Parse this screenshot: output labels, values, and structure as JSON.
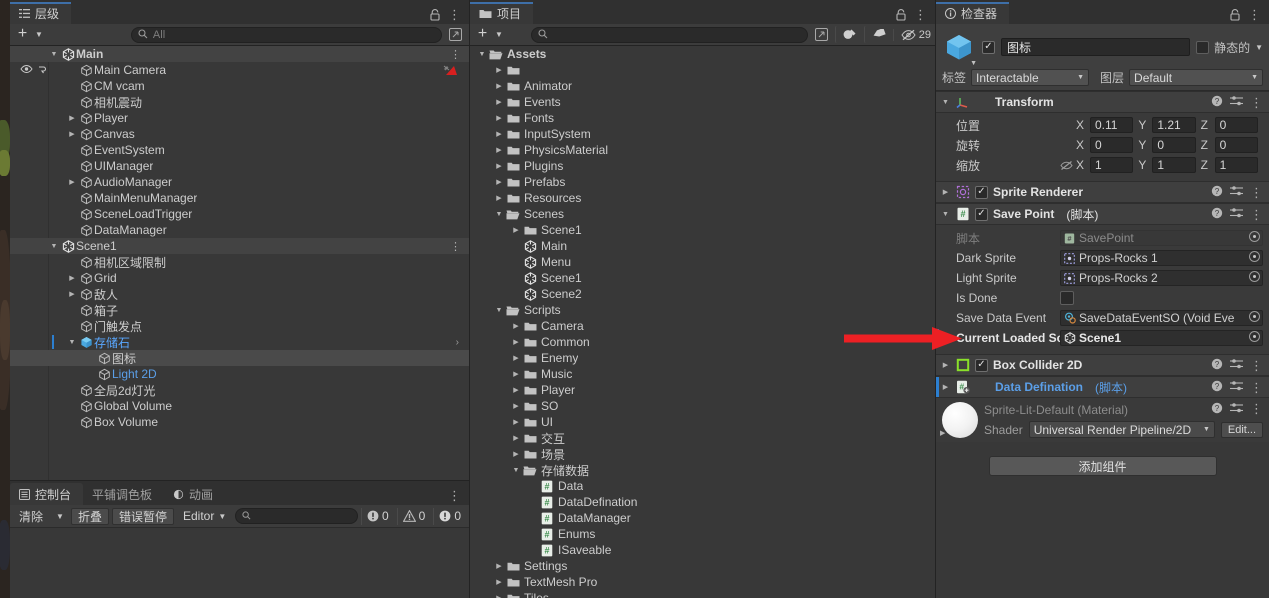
{
  "hierarchy": {
    "tab_label": "层级",
    "tab_icon": "hierarchy-icon",
    "toolbar": {
      "create_label": "+",
      "search_placeholder": "All"
    },
    "rows": [
      {
        "label": "Main",
        "indent": 1,
        "icon": "unity-scene-icon",
        "twirl": "down",
        "bold": true,
        "kebab": true
      },
      {
        "label": "Main Camera",
        "indent": 2,
        "icon": "gameobject-icon",
        "twirl": "none",
        "vis": true,
        "camicon": true
      },
      {
        "label": "CM vcam",
        "indent": 2,
        "icon": "gameobject-icon",
        "twirl": "none"
      },
      {
        "label": "相机震动",
        "indent": 2,
        "icon": "gameobject-icon",
        "twirl": "none"
      },
      {
        "label": "Player",
        "indent": 2,
        "icon": "gameobject-icon",
        "twirl": "right"
      },
      {
        "label": "Canvas",
        "indent": 2,
        "icon": "gameobject-icon",
        "twirl": "right"
      },
      {
        "label": "EventSystem",
        "indent": 2,
        "icon": "gameobject-icon",
        "twirl": "none"
      },
      {
        "label": "UIManager",
        "indent": 2,
        "icon": "gameobject-icon",
        "twirl": "none"
      },
      {
        "label": "AudioManager",
        "indent": 2,
        "icon": "gameobject-icon",
        "twirl": "right"
      },
      {
        "label": "MainMenuManager",
        "indent": 2,
        "icon": "gameobject-icon",
        "twirl": "none"
      },
      {
        "label": "SceneLoadTrigger",
        "indent": 2,
        "icon": "gameobject-icon",
        "twirl": "none"
      },
      {
        "label": "DataManager",
        "indent": 2,
        "icon": "gameobject-icon",
        "twirl": "none"
      },
      {
        "label": "Scene1",
        "indent": 1,
        "icon": "unity-scene-icon",
        "twirl": "down",
        "scene": true,
        "kebab": true
      },
      {
        "label": "相机区域限制",
        "indent": 2,
        "icon": "gameobject-icon",
        "twirl": "none"
      },
      {
        "label": "Grid",
        "indent": 2,
        "icon": "gameobject-icon",
        "twirl": "right"
      },
      {
        "label": "敌人",
        "indent": 2,
        "icon": "gameobject-icon",
        "twirl": "right"
      },
      {
        "label": "箱子",
        "indent": 2,
        "icon": "gameobject-icon",
        "twirl": "none"
      },
      {
        "label": "门触发点",
        "indent": 2,
        "icon": "gameobject-icon",
        "twirl": "none"
      },
      {
        "label": "存储石",
        "indent": 2,
        "icon": "prefab-icon",
        "twirl": "down",
        "prefab": true,
        "chev": true,
        "marker": true
      },
      {
        "label": "图标",
        "indent": 3,
        "icon": "gameobject-icon",
        "twirl": "none",
        "selected": true
      },
      {
        "label": "Light 2D",
        "indent": 3,
        "icon": "gameobject-icon",
        "twirl": "none",
        "prefabblue": true
      },
      {
        "label": "全局2d灯光",
        "indent": 2,
        "icon": "gameobject-icon",
        "twirl": "none"
      },
      {
        "label": "Global Volume",
        "indent": 2,
        "icon": "gameobject-icon",
        "twirl": "none"
      },
      {
        "label": "Box Volume",
        "indent": 2,
        "icon": "gameobject-icon",
        "twirl": "none"
      }
    ]
  },
  "console": {
    "tabs": [
      {
        "label": "控制台",
        "icon": "console-icon",
        "active": true
      },
      {
        "label": "平铺调色板",
        "icon": "palette-icon",
        "active": false
      },
      {
        "label": "动画",
        "icon": "animation-icon",
        "active": false
      }
    ],
    "clear_label": "清除",
    "collapse_label": "折叠",
    "error_pause_label": "错误暂停",
    "editor_label": "Editor",
    "search_placeholder": "",
    "counts": {
      "log": "0",
      "warning": "0",
      "error": "0"
    }
  },
  "project": {
    "tab_label": "项目",
    "tab_icon": "folder-icon",
    "toolbar": {
      "create_label": "+",
      "search_placeholder": "",
      "hidden_count": "29"
    },
    "rows": [
      {
        "label": "Assets",
        "indent": 1,
        "icon": "folder-open-icon",
        "twirl": "down",
        "bold": true
      },
      {
        "label": "",
        "indent": 2,
        "icon": "folder-icon",
        "twirl": "right"
      },
      {
        "label": "Animator",
        "indent": 2,
        "icon": "folder-icon",
        "twirl": "right"
      },
      {
        "label": "Events",
        "indent": 2,
        "icon": "folder-icon",
        "twirl": "right"
      },
      {
        "label": "Fonts",
        "indent": 2,
        "icon": "folder-icon",
        "twirl": "right"
      },
      {
        "label": "InputSystem",
        "indent": 2,
        "icon": "folder-icon",
        "twirl": "right"
      },
      {
        "label": "PhysicsMaterial",
        "indent": 2,
        "icon": "folder-icon",
        "twirl": "right"
      },
      {
        "label": "Plugins",
        "indent": 2,
        "icon": "folder-icon",
        "twirl": "right"
      },
      {
        "label": "Prefabs",
        "indent": 2,
        "icon": "folder-icon",
        "twirl": "right"
      },
      {
        "label": "Resources",
        "indent": 2,
        "icon": "folder-icon",
        "twirl": "right"
      },
      {
        "label": "Scenes",
        "indent": 2,
        "icon": "folder-open-icon",
        "twirl": "down"
      },
      {
        "label": "Scene1",
        "indent": 3,
        "icon": "folder-icon",
        "twirl": "right"
      },
      {
        "label": "Main",
        "indent": 3,
        "icon": "unity-scene-icon",
        "twirl": "none"
      },
      {
        "label": "Menu",
        "indent": 3,
        "icon": "unity-scene-icon",
        "twirl": "none"
      },
      {
        "label": "Scene1",
        "indent": 3,
        "icon": "unity-scene-icon",
        "twirl": "none"
      },
      {
        "label": "Scene2",
        "indent": 3,
        "icon": "unity-scene-icon",
        "twirl": "none"
      },
      {
        "label": "Scripts",
        "indent": 2,
        "icon": "folder-open-icon",
        "twirl": "down"
      },
      {
        "label": "Camera",
        "indent": 3,
        "icon": "folder-icon",
        "twirl": "right"
      },
      {
        "label": "Common",
        "indent": 3,
        "icon": "folder-icon",
        "twirl": "right"
      },
      {
        "label": "Enemy",
        "indent": 3,
        "icon": "folder-icon",
        "twirl": "right"
      },
      {
        "label": "Music",
        "indent": 3,
        "icon": "folder-icon",
        "twirl": "right"
      },
      {
        "label": "Player",
        "indent": 3,
        "icon": "folder-icon",
        "twirl": "right"
      },
      {
        "label": "SO",
        "indent": 3,
        "icon": "folder-icon",
        "twirl": "right"
      },
      {
        "label": "UI",
        "indent": 3,
        "icon": "folder-icon",
        "twirl": "right"
      },
      {
        "label": "交互",
        "indent": 3,
        "icon": "folder-icon",
        "twirl": "right"
      },
      {
        "label": "场景",
        "indent": 3,
        "icon": "folder-icon",
        "twirl": "right"
      },
      {
        "label": "存储数据",
        "indent": 3,
        "icon": "folder-open-icon",
        "twirl": "down"
      },
      {
        "label": "Data",
        "indent": 4,
        "icon": "csharp-script-icon",
        "twirl": "none"
      },
      {
        "label": "DataDefination",
        "indent": 4,
        "icon": "csharp-script-icon",
        "twirl": "none"
      },
      {
        "label": "DataManager",
        "indent": 4,
        "icon": "csharp-script-icon",
        "twirl": "none"
      },
      {
        "label": "Enums",
        "indent": 4,
        "icon": "csharp-script-icon",
        "twirl": "none"
      },
      {
        "label": "ISaveable",
        "indent": 4,
        "icon": "csharp-script-icon",
        "twirl": "none"
      },
      {
        "label": "Settings",
        "indent": 2,
        "icon": "folder-icon",
        "twirl": "right"
      },
      {
        "label": "TextMesh Pro",
        "indent": 2,
        "icon": "folder-icon",
        "twirl": "right"
      },
      {
        "label": "Tiles",
        "indent": 2,
        "icon": "folder-icon",
        "twirl": "right"
      }
    ]
  },
  "inspector": {
    "tab_label": "检查器",
    "tab_icon": "info-icon",
    "object": {
      "enabled": true,
      "name": "图标",
      "static_label": "静态的",
      "static_checked": false,
      "tag_label": "标签",
      "tag_value": "Interactable",
      "layer_label": "图层",
      "layer_value": "Default"
    },
    "transform": {
      "title": "Transform",
      "rows": [
        {
          "label": "位置",
          "x": "0.11",
          "y": "1.21",
          "z": "0"
        },
        {
          "label": "旋转",
          "x": "0",
          "y": "0",
          "z": "0"
        },
        {
          "label": "缩放",
          "x": "1",
          "y": "1",
          "z": "1",
          "lock": true
        }
      ],
      "axis_labels": [
        "X",
        "Y",
        "Z"
      ]
    },
    "components": [
      {
        "title": "Sprite Renderer",
        "subtitle": "",
        "enabled": true,
        "collapsed": true,
        "icon": "sprite-renderer-icon"
      },
      {
        "title": "Save Point",
        "subtitle": "(脚本)",
        "enabled": true,
        "collapsed": false,
        "icon": "csharp-script-icon"
      }
    ],
    "save_point_props": [
      {
        "label": "脚本",
        "value": "SavePoint",
        "type": "object",
        "disabled": true,
        "icon": "script-asset-icon"
      },
      {
        "label": "Dark Sprite",
        "value": "Props-Rocks 1",
        "type": "object",
        "icon": "sprite-icon"
      },
      {
        "label": "Light Sprite",
        "value": "Props-Rocks 2",
        "type": "object",
        "icon": "sprite-icon"
      },
      {
        "label": "Is Done",
        "value": "",
        "type": "checkbox",
        "checked": false
      },
      {
        "label": "Save Data Event",
        "value": "SaveDataEventSO (Void Eve",
        "type": "object",
        "icon": "scriptable-object-icon"
      },
      {
        "label": "Current Loaded Sce",
        "value": "Scene1",
        "type": "object",
        "icon": "unity-scene-icon",
        "highlight": true
      }
    ],
    "components_lower": [
      {
        "title": "Box Collider 2D",
        "subtitle": "",
        "enabled": true,
        "icon": "box-collider-2d-icon"
      },
      {
        "title": "Data Defination",
        "subtitle": "(脚本)",
        "enabled": true,
        "icon": "csharp-script-add-icon",
        "blue": true,
        "selected": true
      }
    ],
    "material": {
      "name": "Sprite-Lit-Default (Material)",
      "shader_label": "Shader",
      "shader_value": "Universal Render Pipeline/2D",
      "edit_label": "Edit..."
    },
    "add_component_label": "添加组件"
  },
  "annotation": {
    "arrow_color": "#ed2024",
    "points_to": "Current Loaded Sce"
  },
  "colors": {
    "panel_bg": "#383838",
    "header_bg": "#3f3f3f",
    "tab_active_underline": "#3e6fa8",
    "selection": "#4a4a4a",
    "accent_blue": "#5b9fe8",
    "marker_blue": "#2c7fd0",
    "arrow_red": "#ed2024"
  }
}
